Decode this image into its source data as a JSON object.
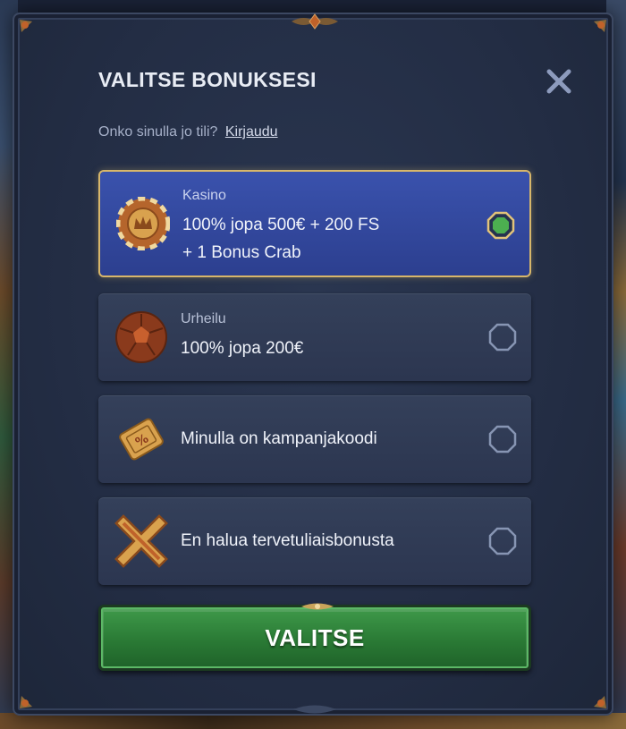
{
  "modal": {
    "title": "VALITSE BONUKSESI",
    "login_prompt": "Onko sinulla jo tili?",
    "login_link": "Kirjaudu"
  },
  "options": [
    {
      "category": "Kasino",
      "line1": "100% jopa 500€ + 200 FS",
      "line2": "+ 1 Bonus Crab",
      "icon": "casino-chip-icon",
      "selected": true
    },
    {
      "category": "Urheilu",
      "line1": "100% jopa 200€",
      "icon": "soccer-ball-icon",
      "selected": false
    },
    {
      "label": "Minulla on kampanjakoodi",
      "icon": "ticket-icon",
      "selected": false
    },
    {
      "label": "En halua tervetuliaisbonusta",
      "icon": "cross-icon",
      "selected": false
    }
  ],
  "submit_label": "VALITSE",
  "colors": {
    "selected_bg": "#3a52ad",
    "selected_border": "#d7b66a",
    "cta_green": "#2a7a35",
    "radio_selected": "#4caf50"
  }
}
